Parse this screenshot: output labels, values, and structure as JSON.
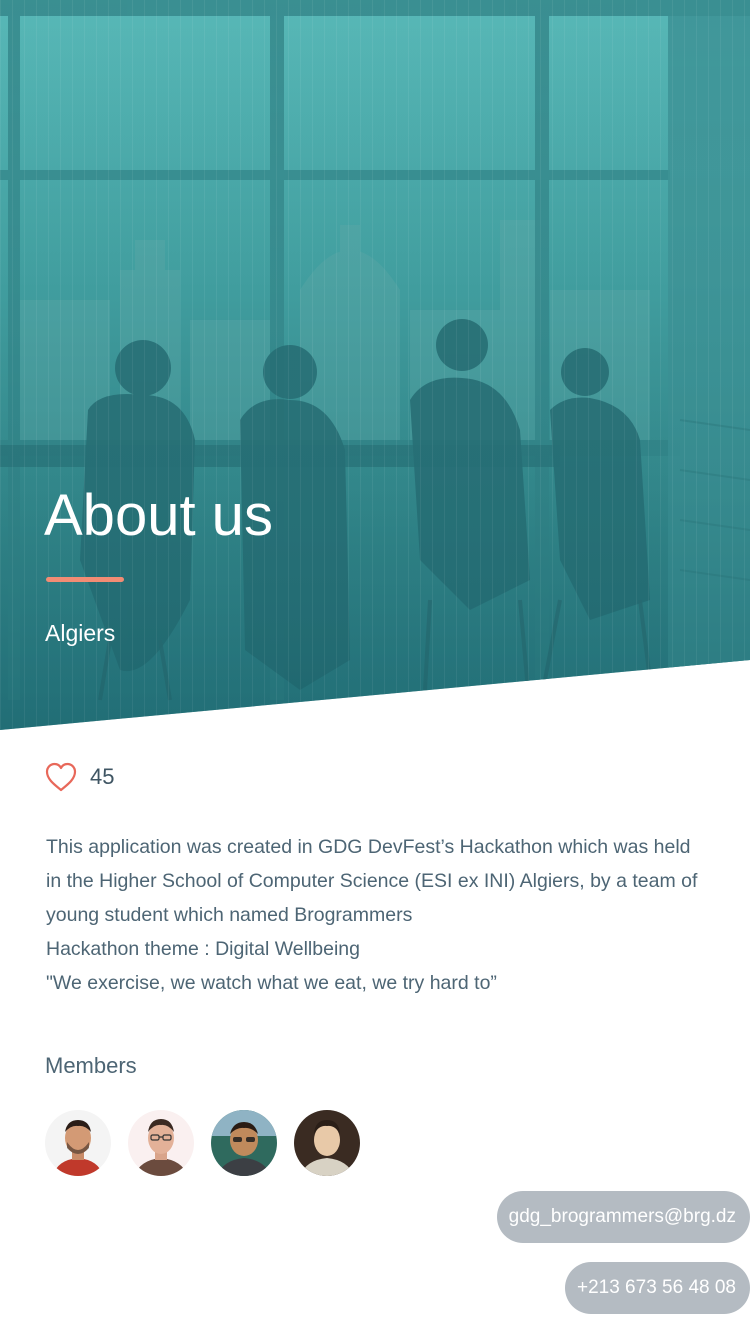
{
  "hero": {
    "title": "About us",
    "location": "Algiers",
    "accent_color": "#f28c74",
    "overlay_color": "#3f9d9e"
  },
  "likes": {
    "icon": "heart-outline-icon",
    "count": "45",
    "icon_color": "#e8685a"
  },
  "description": {
    "lines": [
      "This application was created in GDG DevFest’s Hackathon which was held",
      "in the Higher School of Computer Science (ESI ex INI) Algiers, by a team of",
      "young student which named Brogrammers",
      "Hackathon theme : Digital Wellbeing",
      "\"We exercise, we watch what we eat, we try hard to”"
    ]
  },
  "members": {
    "title": "Members",
    "avatars": [
      "member-1-photo",
      "member-2-photo",
      "member-3-photo",
      "member-4-photo"
    ]
  },
  "contact": {
    "email": "gdg_brogrammers@brg.dz",
    "phone": "+213 673 56 48 08",
    "pill_color": "#b4bbc2"
  }
}
